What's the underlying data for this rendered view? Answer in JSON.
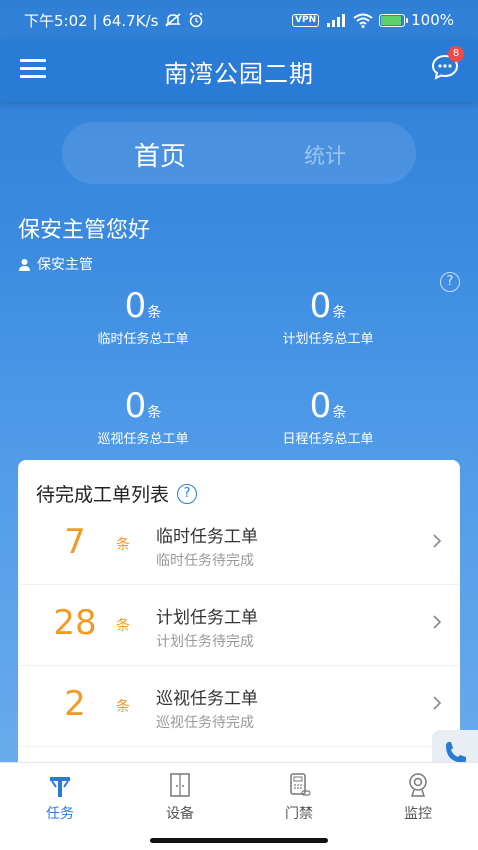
{
  "status_bar": {
    "time_speed": "下午5:02 | 64.7K/s",
    "vpn": "VPN",
    "battery": "100%",
    "battery_level": 0.95
  },
  "app_bar": {
    "title": "南湾公园二期",
    "menu_icon": "hamburger-menu-icon",
    "chat_icon": "chat-bubble-icon",
    "chat_badge": "8"
  },
  "tabs": [
    {
      "label": "首页",
      "active": true
    },
    {
      "label": "统计",
      "active": false
    }
  ],
  "greeting": "保安主管您好",
  "user_role": "保安主管",
  "stats": [
    {
      "value": "0",
      "unit": "条",
      "label": "临时任务总工单"
    },
    {
      "value": "0",
      "unit": "条",
      "label": "计划任务总工单"
    },
    {
      "value": "0",
      "unit": "条",
      "label": "巡视任务总工单"
    },
    {
      "value": "0",
      "unit": "条",
      "label": "日程任务总工单"
    }
  ],
  "pending": {
    "title": "待完成工单列表",
    "help": "?",
    "items": [
      {
        "count": "7",
        "unit": "条",
        "title": "临时任务工单",
        "subtitle": "临时任务待完成"
      },
      {
        "count": "28",
        "unit": "条",
        "title": "计划任务工单",
        "subtitle": "计划任务待完成"
      },
      {
        "count": "2",
        "unit": "条",
        "title": "巡视任务工单",
        "subtitle": "巡视任务待完成"
      }
    ]
  },
  "bottom_nav": [
    {
      "label": "任务",
      "icon": "task-icon",
      "active": true
    },
    {
      "label": "设备",
      "icon": "device-icon",
      "active": false
    },
    {
      "label": "门禁",
      "icon": "access-control-icon",
      "active": false
    },
    {
      "label": "监控",
      "icon": "camera-icon",
      "active": false
    }
  ],
  "colors": {
    "primary": "#2a7bd5",
    "accent_orange": "#f19a28",
    "badge_red": "#ef4b4b"
  }
}
